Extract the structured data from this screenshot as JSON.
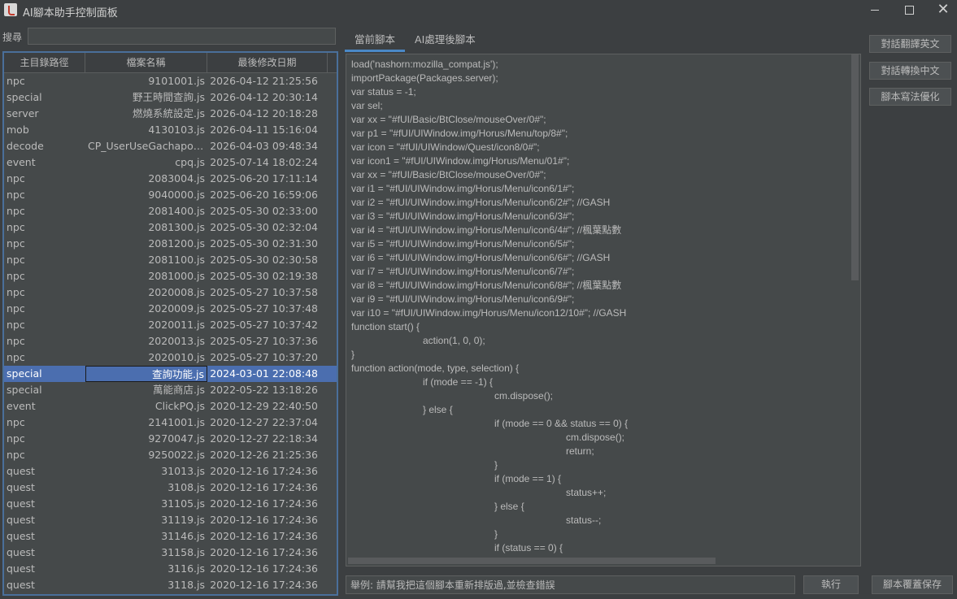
{
  "window": {
    "title": "AI腳本助手控制面板",
    "minimize": "—",
    "maximize": "□",
    "close": "✕",
    "app_icon": "java-icon"
  },
  "search": {
    "label": "搜尋",
    "value": "",
    "placeholder": ""
  },
  "table": {
    "headers": [
      "主目錄路徑",
      "檔案名稱",
      "最後修改日期"
    ],
    "selected_index": 18,
    "rows": [
      [
        "npc",
        "9101001.js",
        "2026-04-12 21:25:56"
      ],
      [
        "special",
        "野王時間查詢.js",
        "2026-04-12 20:30:14"
      ],
      [
        "server",
        "燃燒系統設定.js",
        "2026-04-12 20:18:28"
      ],
      [
        "mob",
        "4130103.js",
        "2026-04-11 15:16:04"
      ],
      [
        "decode",
        "CP_UserUseGachaponRewardRequest.js",
        "2026-04-03 09:48:34"
      ],
      [
        "event",
        "cpq.js",
        "2025-07-14 18:02:24"
      ],
      [
        "npc",
        "2083004.js",
        "2025-06-20 17:11:14"
      ],
      [
        "npc",
        "9040000.js",
        "2025-06-20 16:59:06"
      ],
      [
        "npc",
        "2081400.js",
        "2025-05-30 02:33:00"
      ],
      [
        "npc",
        "2081300.js",
        "2025-05-30 02:32:04"
      ],
      [
        "npc",
        "2081200.js",
        "2025-05-30 02:31:30"
      ],
      [
        "npc",
        "2081100.js",
        "2025-05-30 02:30:58"
      ],
      [
        "npc",
        "2081000.js",
        "2025-05-30 02:19:38"
      ],
      [
        "npc",
        "2020008.js",
        "2025-05-27 10:37:58"
      ],
      [
        "npc",
        "2020009.js",
        "2025-05-27 10:37:48"
      ],
      [
        "npc",
        "2020011.js",
        "2025-05-27 10:37:42"
      ],
      [
        "npc",
        "2020013.js",
        "2025-05-27 10:37:36"
      ],
      [
        "npc",
        "2020010.js",
        "2025-05-27 10:37:20"
      ],
      [
        "special",
        "查詢功能.js",
        "2024-03-01 22:08:48"
      ],
      [
        "special",
        "萬能商店.js",
        "2022-05-22 13:18:26"
      ],
      [
        "event",
        "ClickPQ.js",
        "2020-12-29 22:40:50"
      ],
      [
        "npc",
        "2141001.js",
        "2020-12-27 22:37:04"
      ],
      [
        "npc",
        "9270047.js",
        "2020-12-27 22:18:34"
      ],
      [
        "npc",
        "9250022.js",
        "2020-12-26 21:25:36"
      ],
      [
        "quest",
        "31013.js",
        "2020-12-16 17:24:36"
      ],
      [
        "quest",
        "3108.js",
        "2020-12-16 17:24:36"
      ],
      [
        "quest",
        "31105.js",
        "2020-12-16 17:24:36"
      ],
      [
        "quest",
        "31119.js",
        "2020-12-16 17:24:36"
      ],
      [
        "quest",
        "31146.js",
        "2020-12-16 17:24:36"
      ],
      [
        "quest",
        "31158.js",
        "2020-12-16 17:24:36"
      ],
      [
        "quest",
        "3116.js",
        "2020-12-16 17:24:36"
      ],
      [
        "quest",
        "3118.js",
        "2020-12-16 17:24:36"
      ]
    ]
  },
  "tabs": [
    {
      "label": "當前腳本",
      "active": true
    },
    {
      "label": "AI處理後腳本",
      "active": false
    }
  ],
  "code_lines": [
    "load('nashorn:mozilla_compat.js');",
    "importPackage(Packages.server);",
    "var status = -1;",
    "var sel;",
    "var xx = \"#fUI/Basic/BtClose/mouseOver/0#\";",
    "var p1 = \"#fUI/UIWindow.img/Horus/Menu/top/8#\";",
    "var icon = \"#fUI/UIWindow/Quest/icon8/0#\";",
    "var icon1 = \"#fUI/UIWindow.img/Horus/Menu/01#\";",
    "var xx = \"#fUI/Basic/BtClose/mouseOver/0#\";",
    "var i1 = \"#fUI/UIWindow.img/Horus/Menu/icon6/1#\";",
    "var i2 = \"#fUI/UIWindow.img/Horus/Menu/icon6/2#\"; //GASH",
    "var i3 = \"#fUI/UIWindow.img/Horus/Menu/icon6/3#\";",
    "var i4 = \"#fUI/UIWindow.img/Horus/Menu/icon6/4#\"; //楓葉點數",
    "var i5 = \"#fUI/UIWindow.img/Horus/Menu/icon6/5#\";",
    "var i6 = \"#fUI/UIWindow.img/Horus/Menu/icon6/6#\"; //GASH",
    "var i7 = \"#fUI/UIWindow.img/Horus/Menu/icon6/7#\";",
    "var i8 = \"#fUI/UIWindow.img/Horus/Menu/icon6/8#\"; //楓葉點數",
    "var i9 = \"#fUI/UIWindow.img/Horus/Menu/icon6/9#\";",
    "var i10 = \"#fUI/UIWindow.img/Horus/Menu/icon12/10#\"; //GASH",
    "function start() {",
    "\t\t\t\taction(1, 0, 0);",
    "}",
    "function action(mode, type, selection) {",
    "\t\t\t\tif (mode == -1) {",
    "\t\t\t\t\t\t\t\tcm.dispose();",
    "\t\t\t\t} else {",
    "\t\t\t\t\t\t\t\tif (mode == 0 && status == 0) {",
    "\t\t\t\t\t\t\t\t\t\t\t\tcm.dispose();",
    "\t\t\t\t\t\t\t\t\t\t\t\treturn;",
    "\t\t\t\t\t\t\t\t}",
    "\t\t\t\t\t\t\t\tif (mode == 1) {",
    "\t\t\t\t\t\t\t\t\t\t\t\tstatus++;",
    "\t\t\t\t\t\t\t\t} else {",
    "\t\t\t\t\t\t\t\t\t\t\t\tstatus--;",
    "\t\t\t\t\t\t\t\t}",
    "\t\t\t\t\t\t\t\tif (status == 0) {"
  ],
  "side_buttons": {
    "translate_en": "對話翻譯英文",
    "convert_zh": "對話轉換中文",
    "optimize": "腳本寫法優化"
  },
  "bottom": {
    "command_value": "舉例: 請幫我把這個腳本重新排版過,並檢查錯誤",
    "run_label": "執行",
    "save_label": "腳本覆蓋保存"
  }
}
